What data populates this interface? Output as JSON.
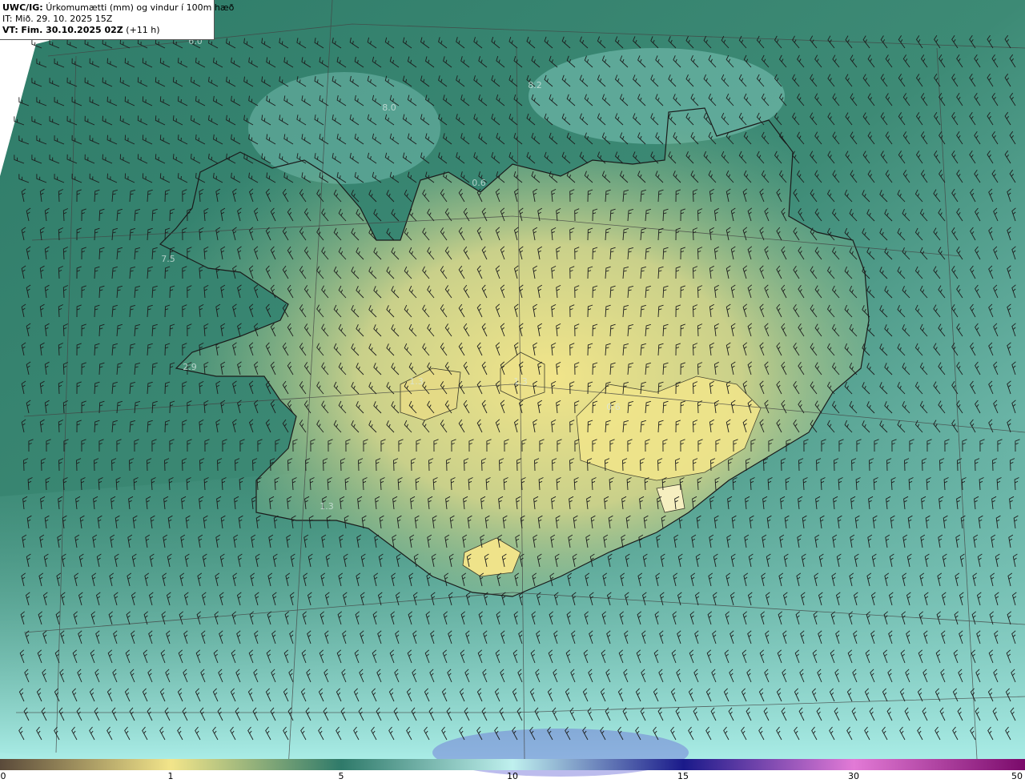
{
  "header": {
    "model": "UWC/IG:",
    "field": "Úrkomumætti (mm) og vindur í 100m hæð",
    "initial_time": "IT: Mið. 29. 10. 2025 15Z",
    "valid_label": "VT:",
    "valid_time": "Fim. 30.10.2025 02Z",
    "lead": "(+11 h)"
  },
  "colorbar": {
    "ticks": [
      "0",
      "1",
      "5",
      "10",
      "15",
      "30",
      "50"
    ],
    "stops": [
      {
        "value": 0,
        "color": "#5a4a3a"
      },
      {
        "value": 1,
        "color": "#f2e58a"
      },
      {
        "value": 5,
        "color": "#2f7a6a"
      },
      {
        "value": 10,
        "color": "#bff0ee"
      },
      {
        "value": 15,
        "color": "#1a1a8a"
      },
      {
        "value": 30,
        "color": "#e27ad6"
      },
      {
        "value": 50,
        "color": "#7a0a6a"
      }
    ]
  },
  "value_labels": [
    "6.0",
    "8.2",
    "8.0",
    "7.5",
    "2.9",
    "1.3",
    "0.6",
    "1.3",
    "0.6",
    "1.3"
  ],
  "colors": {
    "sea_dark": "#2e7a68",
    "land_yellow": "#e6de8a",
    "coast": "#1a1a1a",
    "barb": "#1c1c1c",
    "grid": "#444444"
  }
}
